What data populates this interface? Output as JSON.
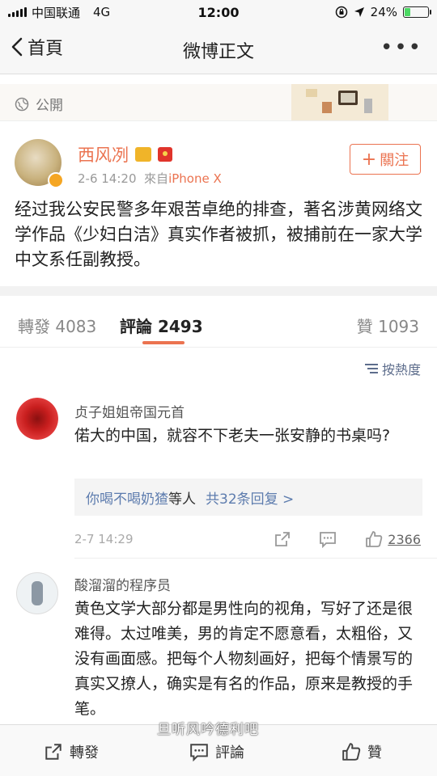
{
  "status_bar": {
    "carrier": "中国联通",
    "network": "4G",
    "time": "12:00",
    "battery": "24%",
    "battery_level": 0.24
  },
  "nav": {
    "back_label": "首頁",
    "title": "微博正文"
  },
  "visibility": {
    "label": "公開"
  },
  "post": {
    "author": "西风冽",
    "date": "2-6 14:20",
    "source_prefix": "來自",
    "source": "iPhone X",
    "follow_label": "關注",
    "text": "经过我公安民警多年艰苦卓绝的排查，著名涉黄网络文学作品《少妇白洁》真实作者被抓，被捕前在一家大学中文系任副教授。"
  },
  "tabs": [
    {
      "label": "轉發",
      "count": "4083"
    },
    {
      "label": "評論",
      "count": "2493"
    },
    {
      "label": "贊",
      "count": "1093"
    }
  ],
  "sort": {
    "label": "按熱度"
  },
  "comments": [
    {
      "author": "贞子姐姐帝国元首",
      "text": "偌大的中国，就容不下老夫一张安静的书桌吗?",
      "reply_preview": {
        "user": "你喝不喝奶猹",
        "suffix": "等人",
        "more": "共32条回复 >"
      },
      "time": "2-7 14:29",
      "likes": "2366"
    },
    {
      "author": "酸溜溜的程序员",
      "text": "黄色文学大部分都是男性向的视角，写好了还是很难得。太过唯美，男的肯定不愿意看，太粗俗，又没有画面感。把每个人物刻画好，把每个情景写的真实又撩人，确实是有名的作品，原来是教授的手笔。"
    }
  ],
  "bottom_bar": {
    "repost": "轉發",
    "comment": "評論",
    "like": "贊"
  },
  "watermark": "旦听风吟德利吧",
  "colors": {
    "accent": "#eb7350",
    "link": "#5d7cae",
    "battery_fill": "#4cd964"
  },
  "icons": [
    "signal-icon",
    "location-arrow-icon",
    "lock-rotation-icon",
    "battery-icon",
    "back-chevron-icon",
    "more-dots-icon",
    "globe-icon",
    "vip-crown-icon",
    "red-envelope-icon",
    "verified-badge-icon",
    "sort-list-icon",
    "share-icon",
    "comment-icon",
    "thumbs-up-icon"
  ]
}
